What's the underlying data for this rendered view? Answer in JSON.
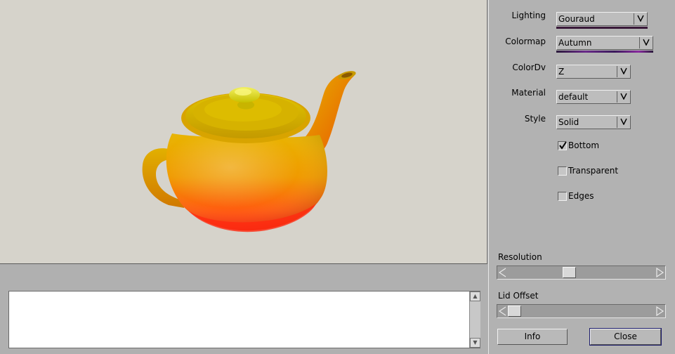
{
  "controls": {
    "lighting": {
      "label": "Lighting",
      "value": "Gouraud"
    },
    "colormap": {
      "label": "Colormap",
      "value": "Autumn"
    },
    "colordv": {
      "label": "ColorDv",
      "value": "Z"
    },
    "material": {
      "label": "Material",
      "value": "default"
    },
    "style": {
      "label": "Style",
      "value": "Solid"
    }
  },
  "checkboxes": [
    {
      "label": "Bottom",
      "checked": true
    },
    {
      "label": "Transparent",
      "checked": false
    },
    {
      "label": "Edges",
      "checked": false
    }
  ],
  "sliders": {
    "resolution": {
      "label": "Resolution",
      "value_fraction": 0.41
    },
    "lid_offset": {
      "label": "Lid Offset",
      "value_fraction": 0.0
    }
  },
  "buttons": {
    "info": "Info",
    "close": "Close"
  },
  "log": {
    "text": ""
  },
  "colors": {
    "viewport_bg": "#d6d3cb",
    "panel_bg": "#b2b2b2",
    "teapot_top": "#e8b800",
    "teapot_bottom": "#ff3a10"
  }
}
